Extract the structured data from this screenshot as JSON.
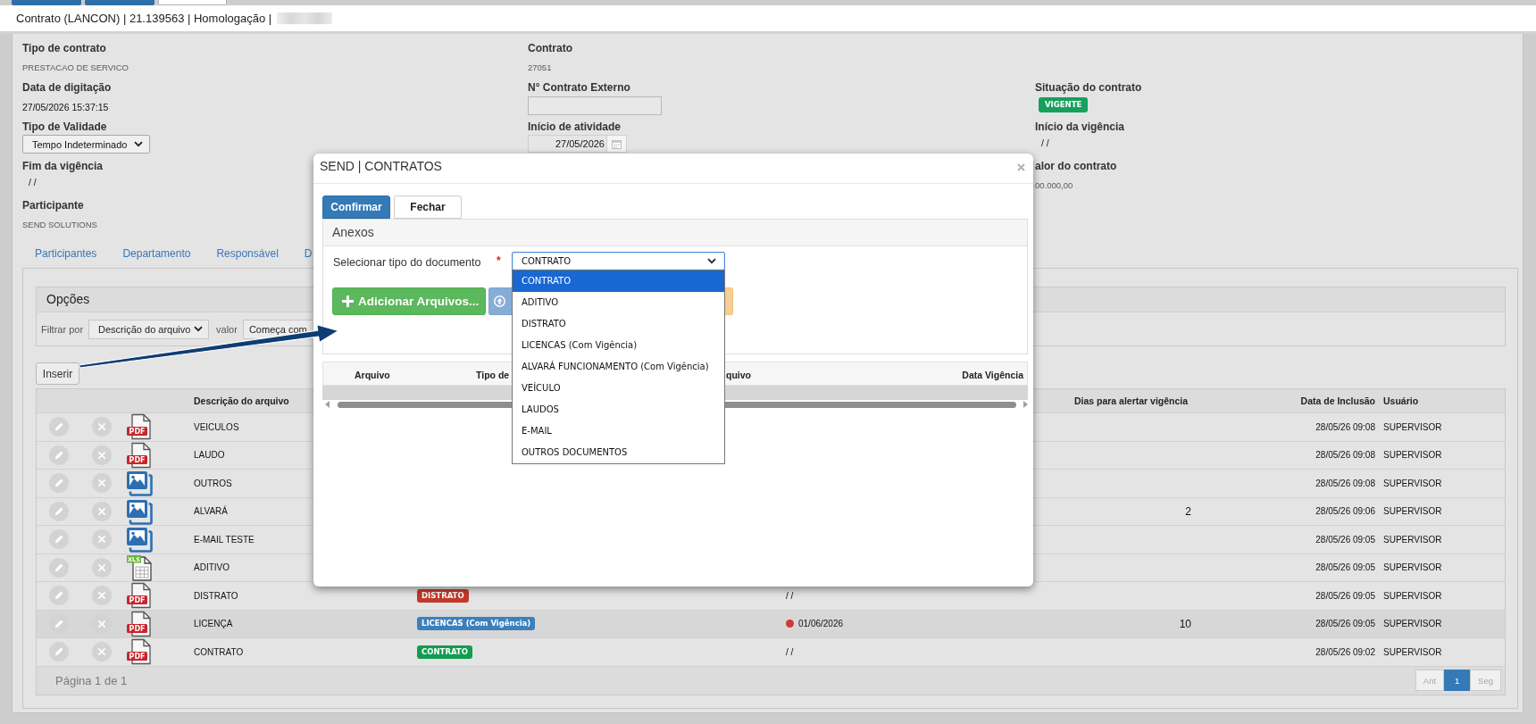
{
  "top_tabs": [
    {
      "selected": false
    },
    {
      "selected": false
    },
    {
      "selected": true
    }
  ],
  "page_title": {
    "text": "Contrato (LANCON) | 21.139563 | Homologação |",
    "redacted": true
  },
  "form": {
    "columns": [
      [
        {
          "label": "Tipo de contrato",
          "kind": "text",
          "value": "PRESTACAO DE SERVICO"
        },
        {
          "label": "Data de digitação",
          "kind": "date",
          "value": "27/05/2026 15:37:15"
        },
        {
          "label": "Tipo de Validade",
          "kind": "select",
          "value": "Tempo Indeterminado"
        },
        {
          "label": "Fim da vigência",
          "kind": "blank_date",
          "value": "/ /"
        },
        {
          "label": "Participante",
          "kind": "text",
          "value": "SEND SOLUTIONS"
        }
      ],
      [
        {
          "label": "Contrato",
          "kind": "text",
          "value": "27051"
        },
        {
          "label": "N° Contrato Externo",
          "kind": "input"
        },
        {
          "label": "Início de atividade",
          "kind": "datepicker",
          "value": "27/05/2026"
        }
      ],
      [
        {
          "label": "Situação do contrato",
          "kind": "badge",
          "value": "VIGENTE"
        },
        {
          "label": "Início da vigência",
          "kind": "blank_date",
          "value": "/ /"
        },
        {
          "label": "alor do contrato",
          "kind": "text",
          "value": "00.000,00"
        }
      ]
    ]
  },
  "section_tabs": [
    {
      "label": "Participantes",
      "selected": false
    },
    {
      "label": "Departamento",
      "selected": false
    },
    {
      "label": "Responsável",
      "selected": false
    },
    {
      "label": "D",
      "selected": false
    }
  ],
  "options_panel": {
    "title": "Opções",
    "filter_label": "Filtrar por",
    "filter_field": "Descrição do arquivo",
    "value_label": "valor",
    "condition": "Começa com"
  },
  "insert_button": "Inserir",
  "files_table": {
    "columns": {
      "description": "Descrição do arquivo",
      "alert_days": "Dias para alertar vigência",
      "included": "Data de Inclusão",
      "user": "Usuário"
    },
    "rows": [
      {
        "file": {
          "kind": "pdf",
          "label": "PDF"
        },
        "description": "VEICULOS",
        "included": "28/05/26 09:08",
        "user": "SUPERVISOR",
        "selected": false
      },
      {
        "file": {
          "kind": "pdf",
          "label": "PDF"
        },
        "description": "LAUDO",
        "included": "28/05/26 09:08",
        "user": "SUPERVISOR",
        "selected": false
      },
      {
        "file": {
          "kind": "image"
        },
        "description": "OUTROS",
        "included": "28/05/26 09:08",
        "user": "SUPERVISOR",
        "selected": false
      },
      {
        "file": {
          "kind": "image"
        },
        "description": "ALVARÁ",
        "alert_days": "2",
        "included": "28/05/26 09:06",
        "user": "SUPERVISOR",
        "selected": false
      },
      {
        "file": {
          "kind": "image"
        },
        "description": "E-MAIL TESTE",
        "included": "28/05/26 09:05",
        "user": "SUPERVISOR",
        "selected": false
      },
      {
        "file": {
          "kind": "spreadsheet",
          "label": "XLS"
        },
        "description": "ADITIVO",
        "included": "28/05/26 09:05",
        "user": "SUPERVISOR",
        "selected": false
      },
      {
        "file": {
          "kind": "pdf",
          "label": "PDF"
        },
        "description": "DISTRATO",
        "type": {
          "text": "DISTRATO",
          "color": "#c2392c"
        },
        "validity": {
          "text": "/ /"
        },
        "included": "28/05/26 09:05",
        "user": "SUPERVISOR",
        "selected": false
      },
      {
        "file": {
          "kind": "pdf",
          "label": "PDF"
        },
        "description": "LICENÇA",
        "type": {
          "text": "LICENCAS (Com Vigência)",
          "color": "#3b80bd"
        },
        "validity": {
          "text": "01/06/2026",
          "color": "#cf3b2e"
        },
        "alert_days": "10",
        "included": "28/05/26 09:05",
        "user": "SUPERVISOR",
        "selected": true
      },
      {
        "file": {
          "kind": "pdf",
          "label": "PDF"
        },
        "description": "CONTRATO",
        "type": {
          "text": "CONTRATO",
          "color": "#139c50"
        },
        "validity": {
          "text": "/ /"
        },
        "included": "28/05/26 09:02",
        "user": "SUPERVISOR",
        "selected": false
      }
    ],
    "footer": {
      "page_info": "Página 1 de 1",
      "pager": [
        {
          "label": "Ant",
          "selected": false,
          "disabled": true
        },
        {
          "label": "1",
          "selected": true,
          "disabled": false
        },
        {
          "label": "Seg",
          "selected": false,
          "disabled": true
        }
      ]
    }
  },
  "modal": {
    "title": "SEND | CONTRATOS",
    "buttons": [
      {
        "label": "Confirmar",
        "kind": "primary"
      },
      {
        "label": "Fechar",
        "kind": "default"
      }
    ],
    "panel_title": "Anexos",
    "document_select": {
      "label": "Selecionar tipo do documento",
      "required_mark": "*",
      "value": "CONTRATO",
      "expanded": true,
      "options": [
        {
          "label": "CONTRATO",
          "selected": true
        },
        {
          "label": "ADITIVO",
          "selected": false
        },
        {
          "label": "DISTRATO",
          "selected": false
        },
        {
          "label": "LICENCAS (Com Vigência)",
          "selected": false
        },
        {
          "label": "ALVARÁ FUNCIONAMENTO (Com Vigência)",
          "selected": false
        },
        {
          "label": "VEÍCULO",
          "selected": false
        },
        {
          "label": "LAUDOS",
          "selected": false
        },
        {
          "label": "E-MAIL",
          "selected": false
        },
        {
          "label": "OUTROS DOCUMENTOS",
          "selected": false
        }
      ]
    },
    "add_button": "Adicionar Arquivos...",
    "attachments_table": {
      "columns": [
        "Arquivo",
        "Tipo de",
        "quivo",
        "Data Vigência"
      ]
    }
  }
}
